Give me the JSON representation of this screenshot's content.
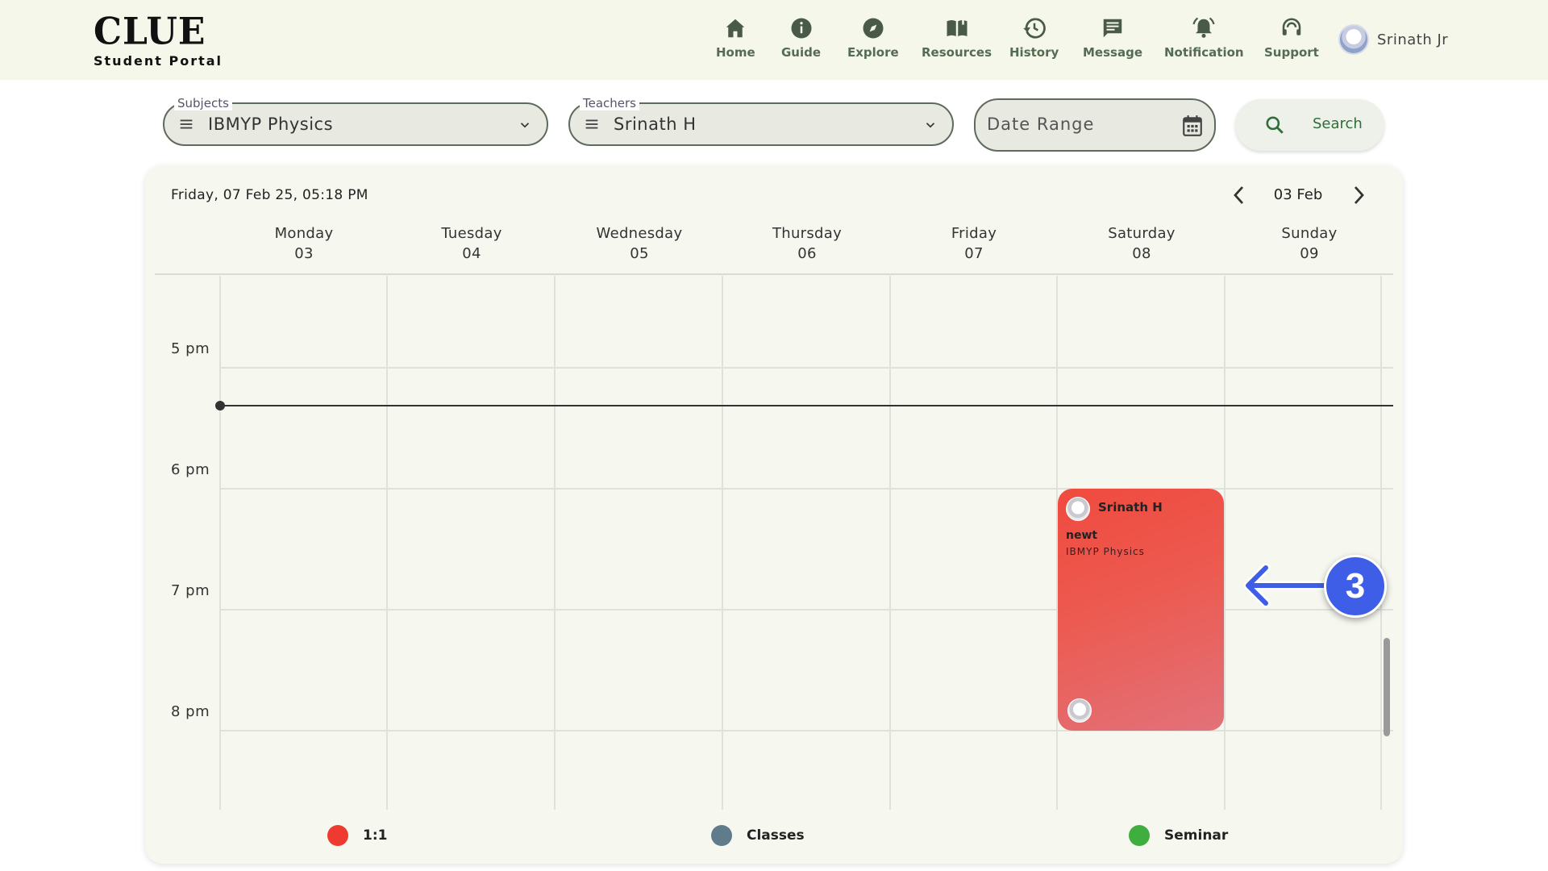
{
  "app": {
    "logo": "CLUE",
    "subtitle": "Student Portal"
  },
  "nav": [
    {
      "label": "Home",
      "icon": "home-icon"
    },
    {
      "label": "Guide",
      "icon": "info-icon"
    },
    {
      "label": "Explore",
      "icon": "compass-icon"
    },
    {
      "label": "Resources",
      "icon": "book-icon"
    },
    {
      "label": "History",
      "icon": "history-icon"
    },
    {
      "label": "Message",
      "icon": "message-icon"
    },
    {
      "label": "Notification",
      "icon": "bell-icon"
    },
    {
      "label": "Support",
      "icon": "headset-icon"
    }
  ],
  "user": {
    "name": "Srinath Jr"
  },
  "filters": {
    "subjects": {
      "label": "Subjects",
      "value": "IBMYP Physics"
    },
    "teachers": {
      "label": "Teachers",
      "value": "Srinath H"
    },
    "date_range": {
      "placeholder": "Date Range"
    },
    "search_label": "Search"
  },
  "calendar": {
    "now_label": "Friday, 07 Feb 25, 05:18 PM",
    "week_label": "03 Feb",
    "days": [
      {
        "name": "Monday",
        "date": "03"
      },
      {
        "name": "Tuesday",
        "date": "04"
      },
      {
        "name": "Wednesday",
        "date": "05"
      },
      {
        "name": "Thursday",
        "date": "06"
      },
      {
        "name": "Friday",
        "date": "07"
      },
      {
        "name": "Saturday",
        "date": "08"
      },
      {
        "name": "Sunday",
        "date": "09"
      }
    ],
    "hours": [
      "5 pm",
      "6 pm",
      "7 pm",
      "8 pm"
    ],
    "event": {
      "teacher": "Srinath H",
      "title": "newt",
      "subject": "IBMYP Physics",
      "color": "#f04a3e"
    }
  },
  "legend": [
    {
      "label": "1:1",
      "color": "#ef3b2f"
    },
    {
      "label": "Classes",
      "color": "#5f7b8c"
    },
    {
      "label": "Seminar",
      "color": "#3fae3f"
    }
  ],
  "callout": {
    "number": "3",
    "color": "#3e5ee8"
  }
}
